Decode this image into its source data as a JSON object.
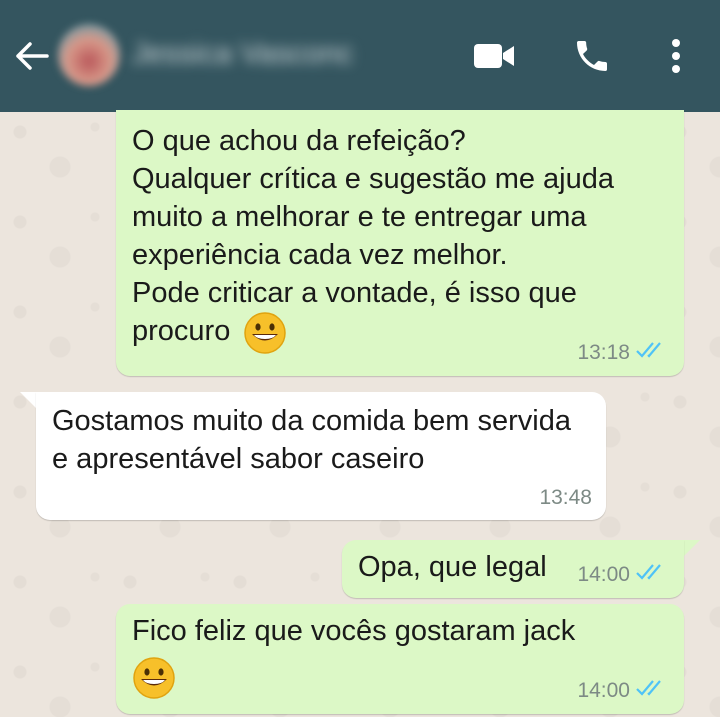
{
  "header": {
    "contact_name": "Jessica Vasconcellos",
    "icons": {
      "back": "arrow-left-icon",
      "video": "video-call-icon",
      "call": "phone-icon",
      "menu": "more-vertical-icon"
    },
    "color": "#34555f"
  },
  "messages": [
    {
      "direction": "outgoing",
      "text": "O que achou da refeição?\nQualquer crítica e sugestão me ajuda muito a melhorar e te entregar uma experiência cada vez melhor.\nPode criticar a vontade, é isso que procuro",
      "time": "13:18",
      "read": true,
      "emoji": "grinning-face"
    },
    {
      "direction": "incoming",
      "text": "Gostamos muito da comida  bem servida e apresentável sabor caseiro",
      "time": "13:48"
    },
    {
      "direction": "outgoing",
      "text": "Opa, que legal",
      "time": "14:00",
      "read": true
    },
    {
      "direction": "outgoing",
      "text": "Fico feliz que vocês gostaram jack",
      "time": "14:00",
      "read": true,
      "emoji": "grinning-face"
    }
  ],
  "colors": {
    "outgoing_bubble": "#dcf8c6",
    "incoming_bubble": "#ffffff",
    "read_ticks": "#4fc3f7",
    "chat_background": "#ece5dd"
  }
}
